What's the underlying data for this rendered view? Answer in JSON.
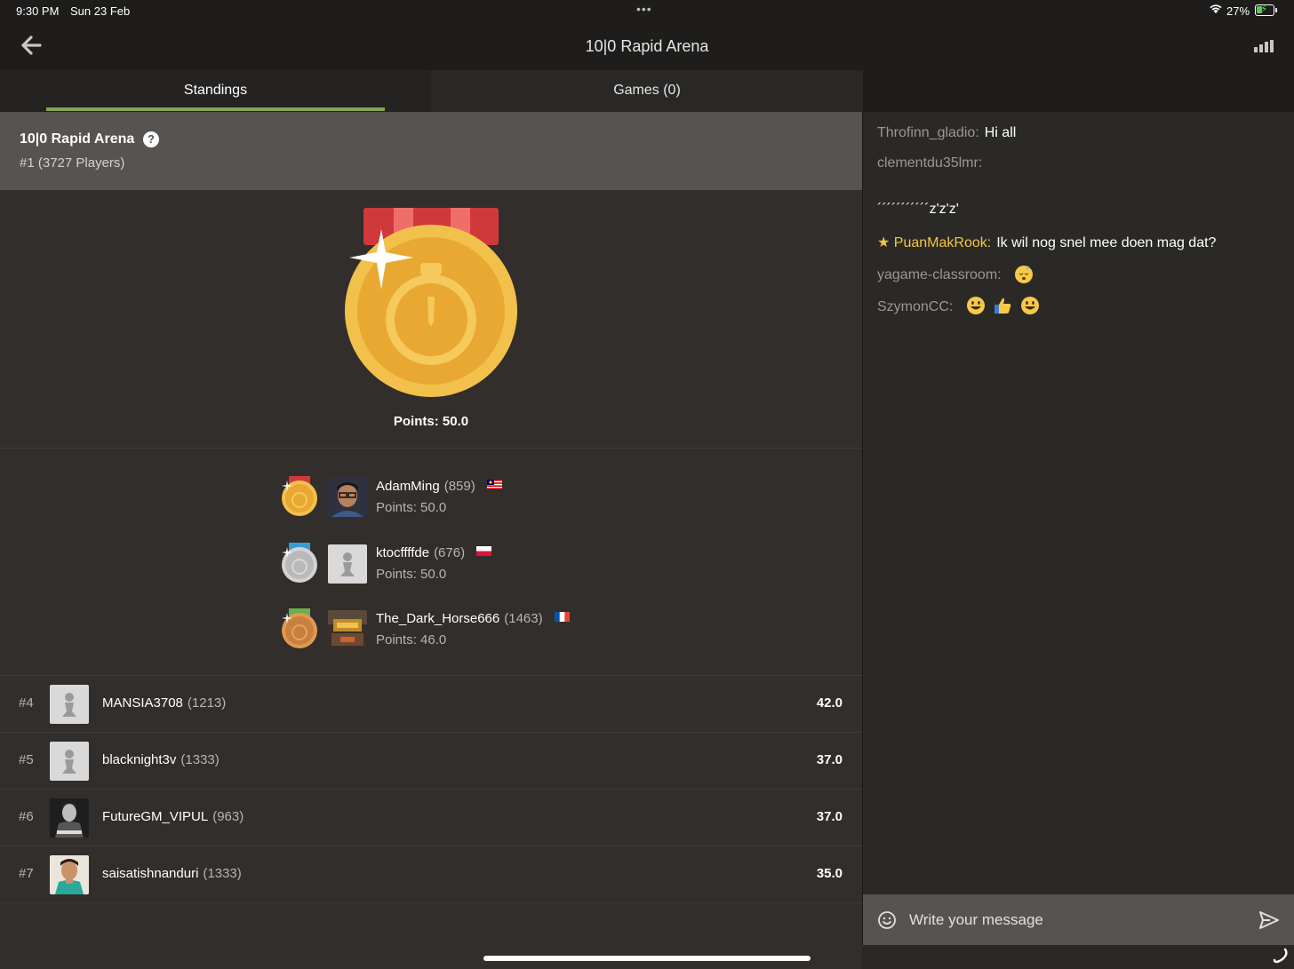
{
  "status_bar": {
    "time": "9:30 PM",
    "date": "Sun 23 Feb",
    "dots": "•••",
    "battery": "27%"
  },
  "nav": {
    "title": "10|0 Rapid Arena",
    "back_icon": "back-arrow-icon",
    "right_icon": "signal-bars-icon"
  },
  "tabs": [
    {
      "label": "Standings",
      "active": true
    },
    {
      "label": "Games (0)",
      "active": false
    }
  ],
  "arena": {
    "name": "10|0 Rapid Arena",
    "help_icon": "?",
    "rank_text": "#1 (3727 Players)",
    "winner_points": "Points: 50.0"
  },
  "podium": [
    {
      "medal": "gold",
      "user": "AdamMing",
      "rating": "(859)",
      "flag": "malaysia",
      "points": "Points: 50.0"
    },
    {
      "medal": "silver",
      "user": "ktocffffde",
      "rating": "(676)",
      "flag": "poland",
      "points": "Points: 50.0"
    },
    {
      "medal": "bronze",
      "user": "The_Dark_Horse666",
      "rating": "(1463)",
      "flag": "france",
      "points": "Points: 46.0"
    }
  ],
  "standings": [
    {
      "rank": "#4",
      "user": "MANSIA3708",
      "rating": "(1213)",
      "score": "42.0"
    },
    {
      "rank": "#5",
      "user": "blacknight3v",
      "rating": "(1333)",
      "score": "37.0"
    },
    {
      "rank": "#6",
      "user": "FutureGM_VIPUL",
      "rating": "(963)",
      "score": "37.0"
    },
    {
      "rank": "#7",
      "user": "saisatishnanduri",
      "rating": "(1333)",
      "score": "35.0"
    }
  ],
  "chat": {
    "messages": [
      {
        "from": "Throfinn_gladio:",
        "text": "Hi all"
      },
      {
        "from": "clementdu35lmr:",
        "text": ""
      },
      {
        "from": "",
        "text": "´´´´´´´´´´´z'z'z'"
      },
      {
        "from": "PuanMakRook:",
        "text": "Ik wil nog snel mee doen mag dat?",
        "star": "★"
      },
      {
        "from": "yagame-classroom:",
        "text": "",
        "emoji": [
          "sleeping-face"
        ]
      },
      {
        "from": "SzymonCC:",
        "text": "",
        "emoji": [
          "smiley-face",
          "thumbs-up",
          "smiley-face"
        ]
      }
    ],
    "input_placeholder": "Write your message"
  },
  "colors": {
    "accent_green": "#7fa650",
    "moderator_yellow": "#f4c542",
    "gold": "#e8a831",
    "silver": "#b9b9b9",
    "bronze": "#c9803c"
  }
}
